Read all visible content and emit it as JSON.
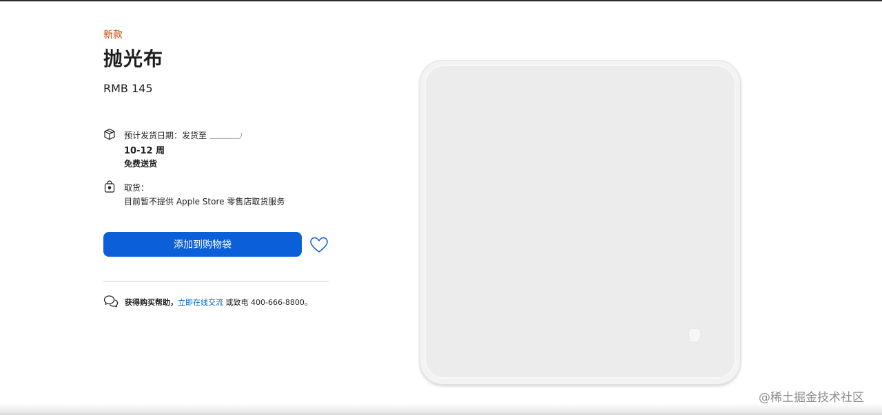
{
  "product": {
    "new_tag": "新款",
    "title": "抛光布",
    "price": "RMB 145"
  },
  "delivery": {
    "label": "预计发货日期：发货至",
    "time": "10-12 周",
    "free_shipping": "免费送货",
    "icon": "box-icon"
  },
  "pickup": {
    "label": "取货：",
    "detail": "目前暂不提供 Apple Store 零售店取货服务",
    "icon": "shopping-bag-icon"
  },
  "actions": {
    "add_to_bag": "添加到购物袋",
    "favorite_icon": "heart-icon"
  },
  "help": {
    "prefix": "获得购买帮助，",
    "chat_link": "立即在线交流",
    "phone_text": " 或致电 400-666-8800。",
    "icon": "chat-bubbles-icon"
  },
  "watermark": "@稀土掘金技术社区",
  "colors": {
    "accent": "#0b5fd8",
    "new_tag": "#bf4800",
    "link": "#0066cc"
  }
}
